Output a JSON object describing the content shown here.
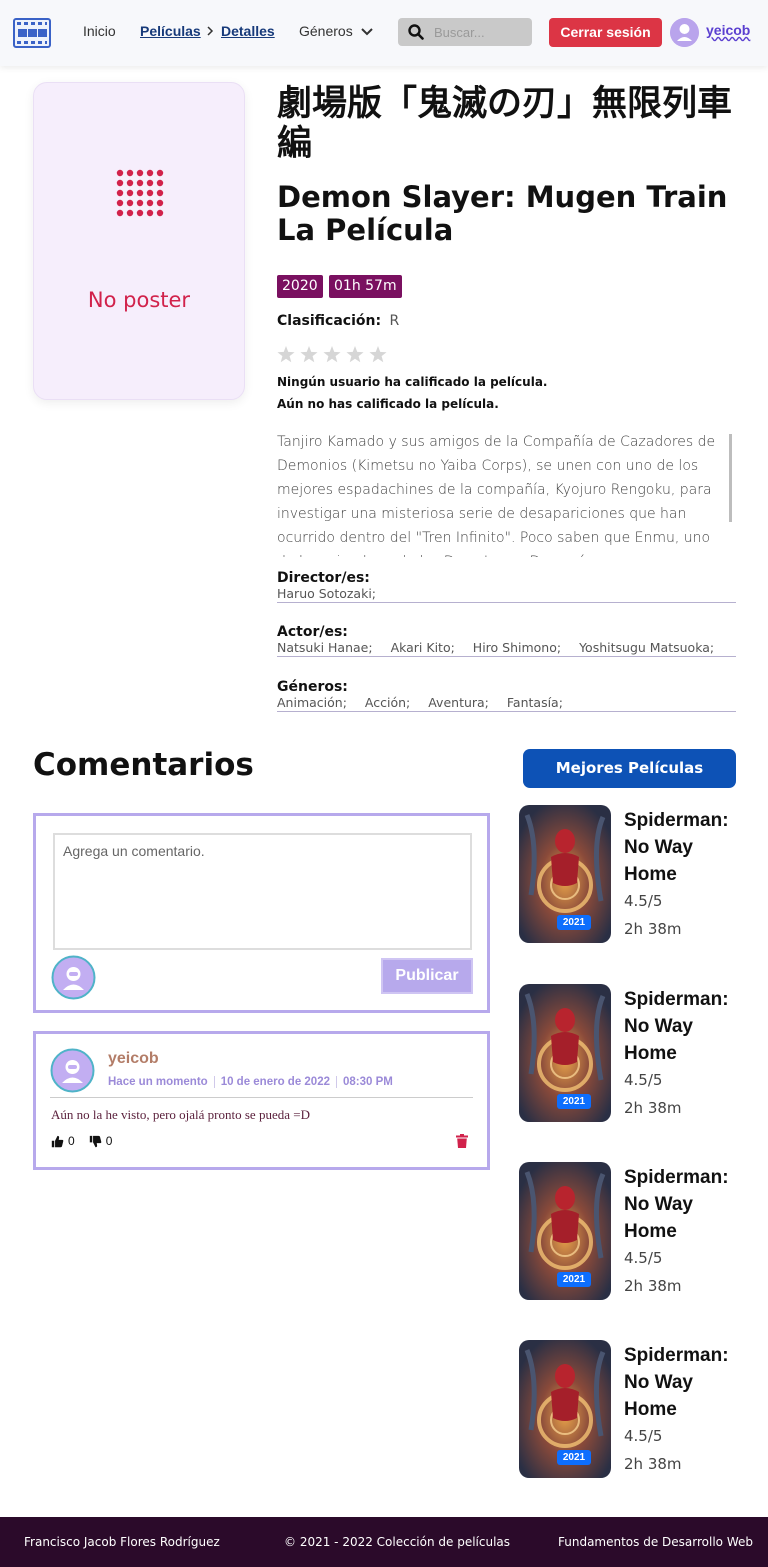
{
  "nav": {
    "home": "Inicio",
    "breadcrumb": [
      "Películas",
      "Detalles"
    ],
    "genres": "Géneros",
    "search_placeholder": "Buscar...",
    "logout": "Cerrar sesión",
    "username": "yeicob"
  },
  "movie": {
    "poster_placeholder": "No poster",
    "title_original": "劇場版「鬼滅の刃」無限列車編",
    "title_spanish": "Demon Slayer: Mugen Train La Película",
    "year": "2020",
    "duration": "01h 57m",
    "rating_label": "Clasificación:",
    "rating_value": "R",
    "stars": 0,
    "no_user_rating": "Ningún usuario ha calificado la película.",
    "no_own_rating": "Aún no has calificado la película.",
    "synopsis": "Tanjiro Kamado y sus amigos de la Compañía de Cazadores de Demonios (Kimetsu no Yaiba Corps), se unen con uno de los mejores espadachines de la compañía, Kyojuro Rengoku, para investigar una misteriosa serie de desapariciones que han ocurrido dentro del \"Tren Infinito\". Poco saben que Enmu, uno de los miembros de los Doce Lunas Demoníacas...",
    "director_label": "Director/es:",
    "directors": [
      "Haruo Sotozaki;"
    ],
    "actors_label": "Actor/es:",
    "actors": [
      "Natsuki Hanae;",
      "Akari Kito;",
      "Hiro Shimono;",
      "Yoshitsugu Matsuoka;"
    ],
    "genres_label": "Géneros:",
    "genres": [
      "Animación;",
      "Acción;",
      "Aventura;",
      "Fantasía;"
    ]
  },
  "comments": {
    "title": "Comentarios",
    "input_placeholder": "Agrega un comentario.",
    "publish": "Publicar",
    "items": [
      {
        "user": "yeicob",
        "relative_time": "Hace un momento",
        "date": "10 de enero de 2022",
        "time": "08:30 PM",
        "text": "Aún no la he visto, pero ojalá pronto se pueda =D",
        "likes": "0",
        "dislikes": "0"
      }
    ]
  },
  "top_movies": {
    "button": "Mejores Películas",
    "items": [
      {
        "title": "Spiderman: No Way Home",
        "year": "2021",
        "rating": "4.5/5",
        "duration": "2h 38m"
      },
      {
        "title": "Spiderman: No Way Home",
        "year": "2021",
        "rating": "4.5/5",
        "duration": "2h 38m"
      },
      {
        "title": "Spiderman: No Way Home",
        "year": "2021",
        "rating": "4.5/5",
        "duration": "2h 38m"
      },
      {
        "title": "Spiderman: No Way Home",
        "year": "2021",
        "rating": "4.5/5",
        "duration": "2h 38m"
      }
    ]
  },
  "footer": {
    "author": "Francisco Jacob Flores Rodríguez",
    "copyright": "© 2021 - 2022 Colección de películas",
    "course": "Fundamentos de Desarrollo Web"
  },
  "colors": {
    "accent_red": "#dc3545",
    "badge_purple": "#7a1060",
    "comment_border": "#b7a9ec",
    "primary_blue": "#0d52b6",
    "footer_bg": "#2b0a2a"
  }
}
